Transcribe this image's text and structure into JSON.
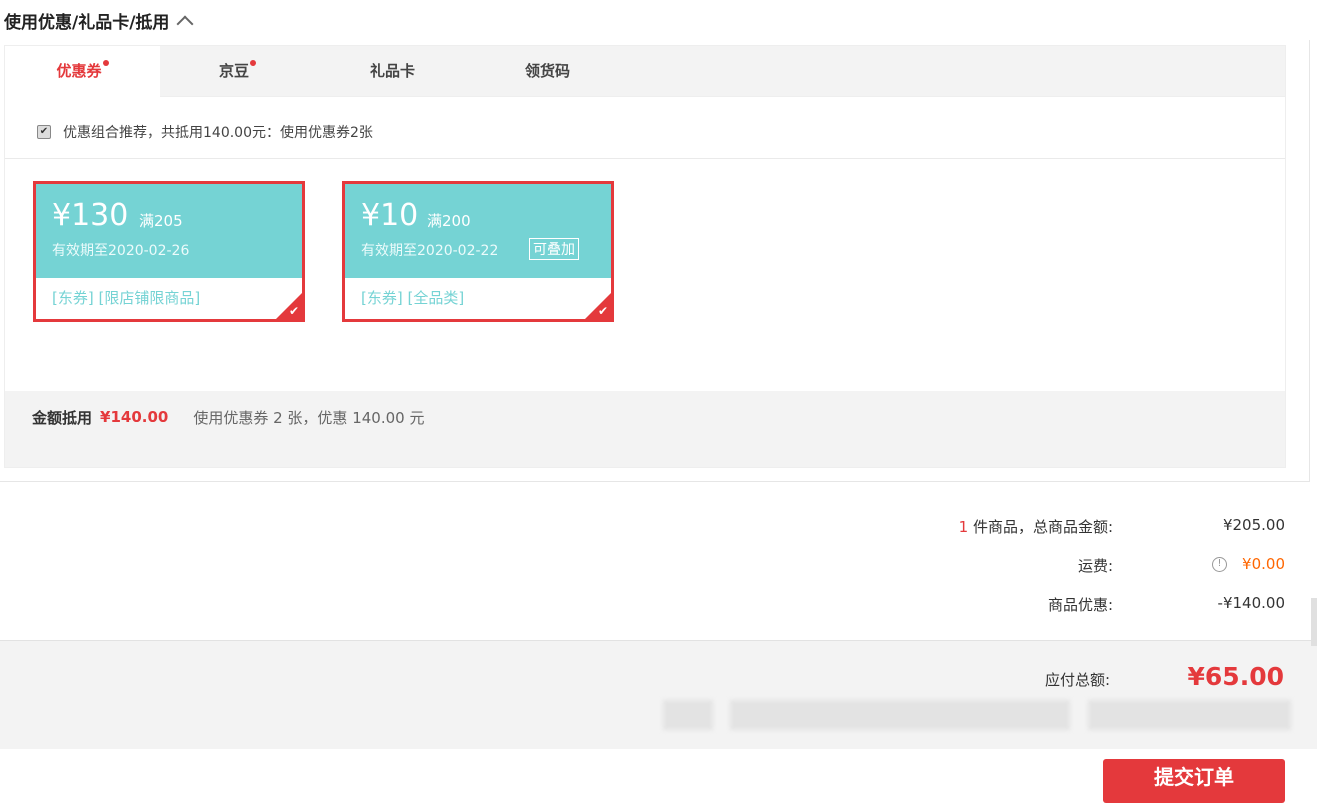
{
  "section": {
    "title": "使用优惠/礼品卡/抵用"
  },
  "tabs": [
    {
      "label": "优惠券",
      "active": true,
      "dot": true
    },
    {
      "label": "京豆",
      "active": false,
      "dot": true
    },
    {
      "label": "礼品卡",
      "active": false,
      "dot": false
    },
    {
      "label": "领货码",
      "active": false,
      "dot": false
    }
  ],
  "combo": {
    "checked": true,
    "text": "优惠组合推荐，共抵用140.00元：使用优惠券2张"
  },
  "coupons": [
    {
      "amount": "¥130",
      "condition": "满205",
      "expiry": "有效期至2020-02-26",
      "stack_label": "",
      "scope": "[东券] [限店铺限商品]",
      "selected": true
    },
    {
      "amount": "¥10",
      "condition": "满200",
      "expiry": "有效期至2020-02-22",
      "stack_label": "可叠加",
      "scope": "[东券] [全品类]",
      "selected": true
    }
  ],
  "summary": {
    "label": "金额抵用",
    "amount": "¥140.00",
    "desc": "使用优惠券 2 张，优惠 140.00 元"
  },
  "prices": {
    "items_count": "1",
    "items_label": " 件商品，总商品金额:",
    "items_value": "¥205.00",
    "shipping_label": "运费:",
    "shipping_value": "¥0.00",
    "discount_label": "商品优惠:",
    "discount_value": "-¥140.00"
  },
  "grand_total": {
    "label": "应付总额:",
    "value": "¥65.00"
  },
  "submit": {
    "label": "提交订单"
  },
  "icons": {
    "collapse": "chevron-up-icon",
    "info": "info-circle-icon",
    "check": "check-icon"
  },
  "colors": {
    "accent": "#e4393c",
    "coupon_bg": "#75d3d4",
    "shipping": "#ff6600"
  }
}
